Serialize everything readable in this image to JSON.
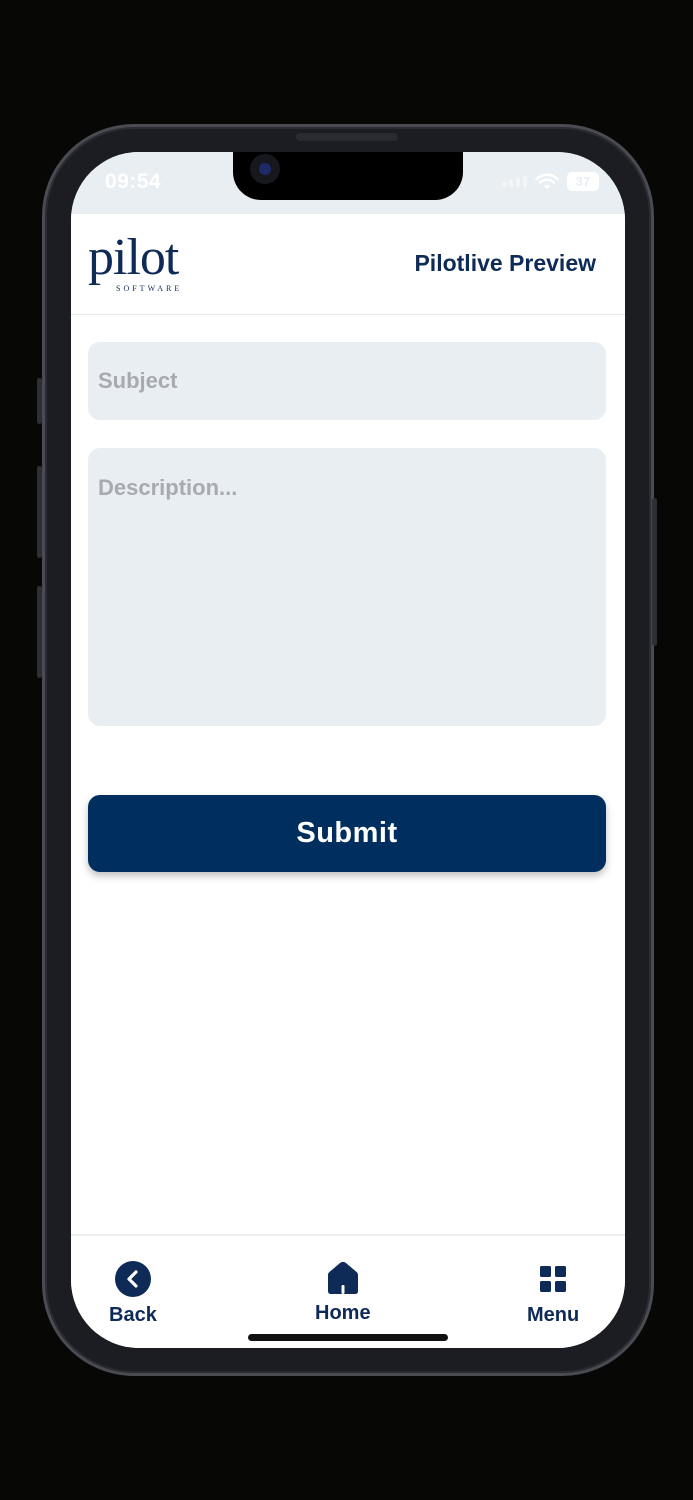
{
  "status_bar": {
    "time": "09:54",
    "battery": "37"
  },
  "header": {
    "logo_text": "pilot",
    "logo_subtext": "SOFTWARE",
    "title": "Pilotlive Preview"
  },
  "form": {
    "subject_placeholder": "Subject",
    "subject_value": "",
    "description_placeholder": "Description...",
    "description_value": "",
    "submit_label": "Submit"
  },
  "bottom_nav": {
    "items": [
      {
        "label": "Back",
        "icon": "chevron-left-circle-icon"
      },
      {
        "label": "Home",
        "icon": "home-icon"
      },
      {
        "label": "Menu",
        "icon": "grid-icon"
      }
    ]
  },
  "colors": {
    "brand": "#0E2A57",
    "button": "#002E5E",
    "field_bg": "#E9EEF2"
  }
}
